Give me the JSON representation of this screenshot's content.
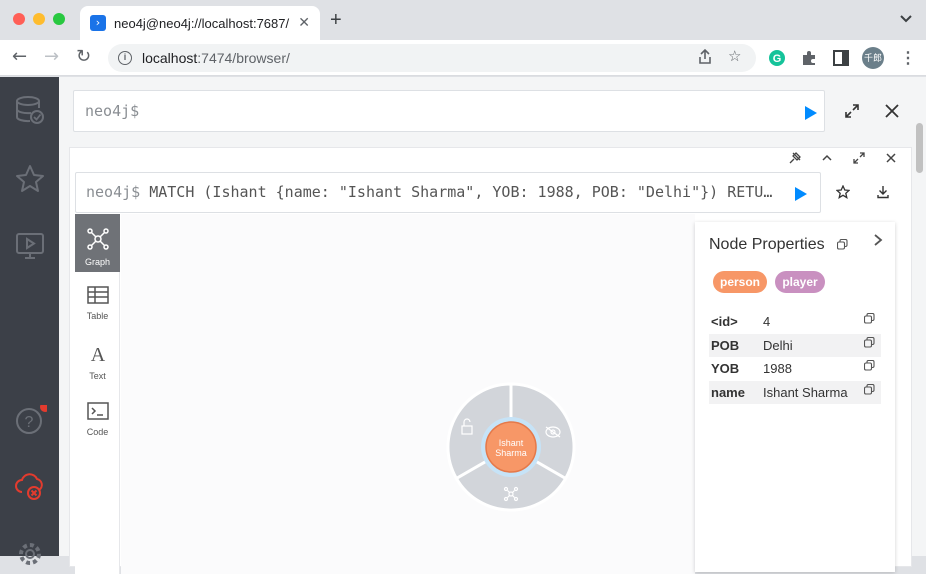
{
  "browser": {
    "tab_title": "neo4j@neo4j://localhost:7687/",
    "url_host": "localhost",
    "url_rest": ":7474/browser/",
    "avatar_text": "千郎"
  },
  "editor": {
    "prompt": "neo4j$"
  },
  "frame": {
    "prompt": "neo4j$",
    "query": "MATCH (Ishant {name: \"Ishant Sharma\", YOB: 1988, POB: \"Delhi\"}) RETURN Ishant"
  },
  "view_tabs": [
    {
      "label": "Graph",
      "icon": "graph-icon"
    },
    {
      "label": "Table",
      "icon": "table-icon"
    },
    {
      "label": "Text",
      "icon": "text-icon"
    },
    {
      "label": "Code",
      "icon": "code-icon"
    }
  ],
  "node": {
    "line1": "Ishant",
    "line2": "Sharma",
    "color": "#f79767"
  },
  "properties": {
    "title": "Node Properties",
    "labels": [
      {
        "name": "person",
        "color": "#f79767"
      },
      {
        "name": "player",
        "color": "#c990c0"
      }
    ],
    "rows": [
      {
        "key": "<id>",
        "value": "4"
      },
      {
        "key": "POB",
        "value": "Delhi"
      },
      {
        "key": "YOB",
        "value": "1988"
      },
      {
        "key": "name",
        "value": "Ishant Sharma"
      }
    ]
  },
  "colors": {
    "accent": "#018bff",
    "sidebar": "#3c4048"
  }
}
